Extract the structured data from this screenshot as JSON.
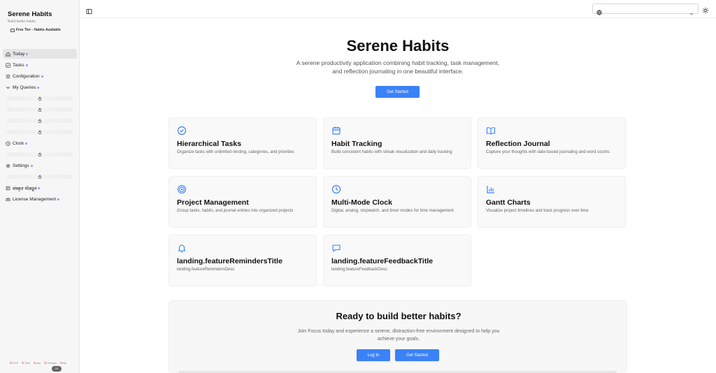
{
  "sidebar": {
    "app_title": "Serene Habits",
    "tagline": "Build better habits",
    "tier": "Free Tier - Habits Available",
    "nav": [
      {
        "label": "Today",
        "icon": "home-icon"
      },
      {
        "label": "Tasks",
        "icon": "check-square-icon"
      },
      {
        "label": "Configuration",
        "icon": "list-icon"
      },
      {
        "label": "My Queries",
        "icon": "chevron-down-icon"
      },
      {
        "label": "Clock",
        "icon": "clock-icon"
      },
      {
        "label": "Settings",
        "icon": "gear-icon"
      },
      {
        "label": "संस्कृत मोड्यूलं",
        "icon": "book-icon"
      },
      {
        "label": "License Management",
        "icon": "crown-icon"
      }
    ],
    "languages": [
      "DCF",
      "Tibe",
      "yue",
      "Holoiya",
      "tab"
    ],
    "scroll_indicator": "10"
  },
  "topbar": {
    "language_select_value": ""
  },
  "hero": {
    "title": "Serene Habits",
    "subtitle": "A serene productivity application combining habit tracking, task management, and reflection journaling in one beautiful interface.",
    "cta_label": "Get Started"
  },
  "features": [
    {
      "icon": "check-circle-icon",
      "title": "Hierarchical Tasks",
      "desc": "Organize tasks with unlimited nesting, categories, and priorities"
    },
    {
      "icon": "calendar-icon",
      "title": "Habit Tracking",
      "desc": "Build consistent habits with streak visualization and daily tracking"
    },
    {
      "icon": "book-open-icon",
      "title": "Reflection Journal",
      "desc": "Capture your thoughts with date-based journaling and word counts"
    },
    {
      "icon": "target-icon",
      "title": "Project Management",
      "desc": "Group tasks, habits, and journal entries into organized projects"
    },
    {
      "icon": "clock-icon",
      "title": "Multi-Mode Clock",
      "desc": "Digital, analog, stopwatch, and timer modes for time management"
    },
    {
      "icon": "bar-chart-icon",
      "title": "Gantt Charts",
      "desc": "Visualize project timelines and track progress over time"
    },
    {
      "icon": "bell-icon",
      "title": "landing.featureRemindersTitle",
      "desc": "landing.featureRemindersDesc"
    },
    {
      "icon": "message-square-icon",
      "title": "landing.featureFeedbackTitle",
      "desc": "landing.featureFeedbackDesc"
    }
  ],
  "cta": {
    "title": "Ready to build better habits?",
    "subtitle": "Join Focus today and experience a serene, distraction-free environment designed to help you achieve your goals.",
    "login_label": "Log In",
    "start_label": "Get Started"
  },
  "colors": {
    "accent": "#3b82f6",
    "icon_blue": "#3b82f6",
    "badge_purple": "#a78bfa"
  }
}
